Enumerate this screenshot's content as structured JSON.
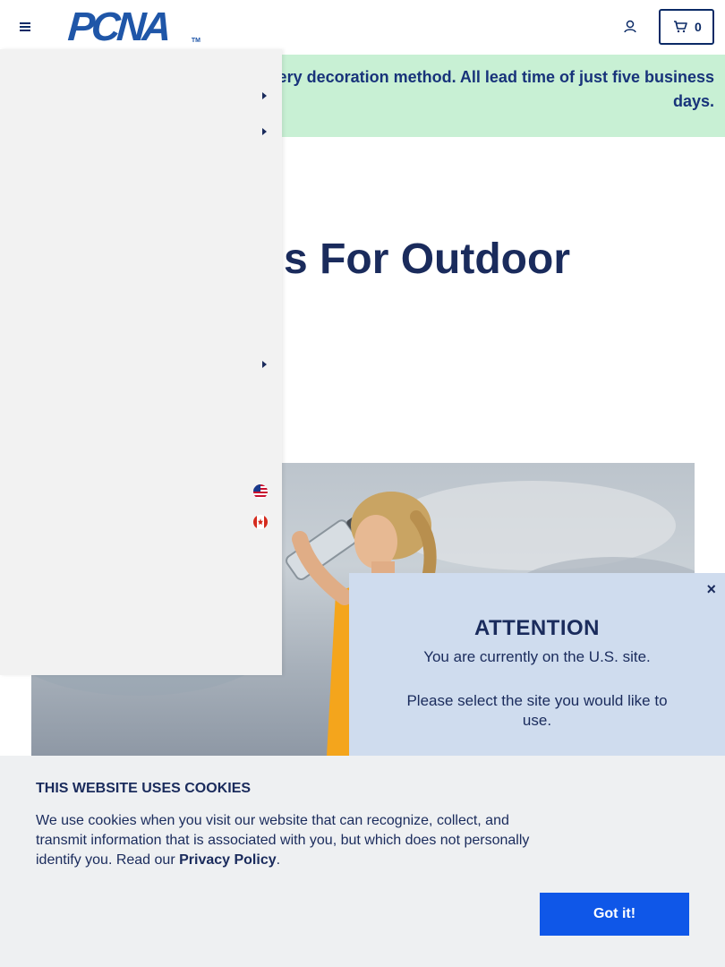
{
  "header": {
    "logo_text": "PCNA",
    "logo_tm": "TM",
    "cart_count": "0"
  },
  "banner": {
    "text": "s. Dozens of retail brands. Every decoration method. All lead time of just five business days."
  },
  "hero": {
    "heading": "s For Outdoor"
  },
  "attention": {
    "close": "×",
    "title": "ATTENTION",
    "message": "You are currently on the U.S. site.",
    "prompt": "Please select the site you would like to use."
  },
  "cookie": {
    "title": "THIS WEBSITE USES COOKIES",
    "text_before": "We use cookies when you visit our website that can recognize, collect, and transmit information that is associated with you, but which does not personally identify you. Read our ",
    "link": "Privacy Policy",
    "text_after": ".",
    "button": "Got it!"
  },
  "icons": {
    "menu": "hamburger-icon",
    "account": "user-icon",
    "cart": "cart-icon",
    "chevron": "chevron-right-icon",
    "flag_us": "us-flag-icon",
    "flag_ca": "canada-flag-icon"
  },
  "colors": {
    "brand_navy": "#1a2b5c",
    "logo_blue": "#1f56a8",
    "banner_bg": "#c8f0d4",
    "attention_bg": "#cfdcee",
    "cookie_button": "#0f57e8"
  }
}
